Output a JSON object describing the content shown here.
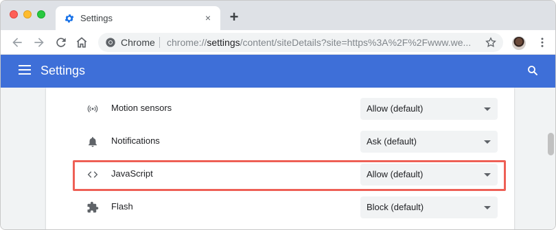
{
  "browser": {
    "tab": {
      "title": "Settings",
      "favicon": "gear-icon",
      "close_glyph": "×"
    },
    "new_tab_glyph": "+",
    "omnibox": {
      "site_label": "Chrome",
      "url_prefix": "chrome://",
      "url_host": "settings",
      "url_rest": "/content/siteDetails?site=https%3A%2F%2Fwww.we..."
    }
  },
  "header": {
    "title": "Settings",
    "menu_icon": "hamburger-icon",
    "search_icon": "search-icon"
  },
  "permissions": [
    {
      "icon": "sensors-icon",
      "label": "Motion sensors",
      "value": "Allow (default)"
    },
    {
      "icon": "bell-icon",
      "label": "Notifications",
      "value": "Ask (default)"
    },
    {
      "icon": "code-icon",
      "label": "JavaScript",
      "value": "Allow (default)"
    },
    {
      "icon": "puzzle-icon",
      "label": "Flash",
      "value": "Block (default)"
    }
  ],
  "colors": {
    "header_bg": "#3e6fd8",
    "highlight": "#ee5f55",
    "content_bg": "#f1f3f4"
  }
}
